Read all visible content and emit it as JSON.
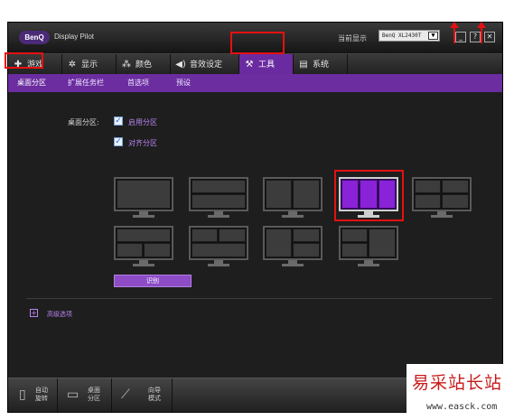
{
  "app": {
    "logo_text": "BenQ",
    "name": "Display Pilot"
  },
  "titlebar": {
    "current_display_label": "当前显示",
    "monitor_value": "BenQ XL2430T",
    "dropdown_icon": "chevron-down-icon",
    "min_label": "_",
    "help_label": "?",
    "close_label": "✕"
  },
  "tabs": [
    {
      "label": "游戏",
      "icon": "gamepad-icon",
      "glyph": "🎮"
    },
    {
      "label": "显示",
      "icon": "brightness-icon",
      "glyph": "✲"
    },
    {
      "label": "颜色",
      "icon": "color-dots-icon",
      "glyph": "⁂"
    },
    {
      "label": "音效设定",
      "icon": "speaker-icon",
      "glyph": "🔊"
    },
    {
      "label": "工具",
      "icon": "wrench-icon",
      "glyph": "🔧",
      "active": true
    },
    {
      "label": "系统",
      "icon": "system-icon",
      "glyph": "▤"
    }
  ],
  "subnav": [
    {
      "label": "桌面分区",
      "active": true
    },
    {
      "label": "扩展任务栏"
    },
    {
      "label": "首选项"
    },
    {
      "label": "预设"
    }
  ],
  "content": {
    "desktop_partition_label": "桌面分区:",
    "enable_partition_label": "启用分区",
    "enable_partition_checked": true,
    "align_partition_label": "对齐分区",
    "align_partition_checked": true,
    "layouts": [
      "single",
      "two-horizontal",
      "two-vertical",
      "three-vertical",
      "four-grid",
      "three-top-split",
      "three-bottom-split",
      "left-plus-two-right",
      "two-left-plus-right"
    ],
    "selected_layout": "three-vertical",
    "identify_label": "识别",
    "advanced_label": "高级选项",
    "advanced_icon": "plus-icon"
  },
  "bottombar": [
    {
      "label": "自动\n旋转",
      "icon": "rotate-monitor-icon"
    },
    {
      "label": "桌面\n分区",
      "icon": "desktop-partition-icon"
    },
    {
      "label": "向导\n模式",
      "icon": "wand-icon"
    }
  ],
  "watermark": {
    "text_cn": "易采站长站",
    "url": "www.easck.com"
  },
  "colors": {
    "accent": "#6b2da0",
    "selected_panel": "#8a22d8",
    "highlight_box": "#e51010"
  }
}
